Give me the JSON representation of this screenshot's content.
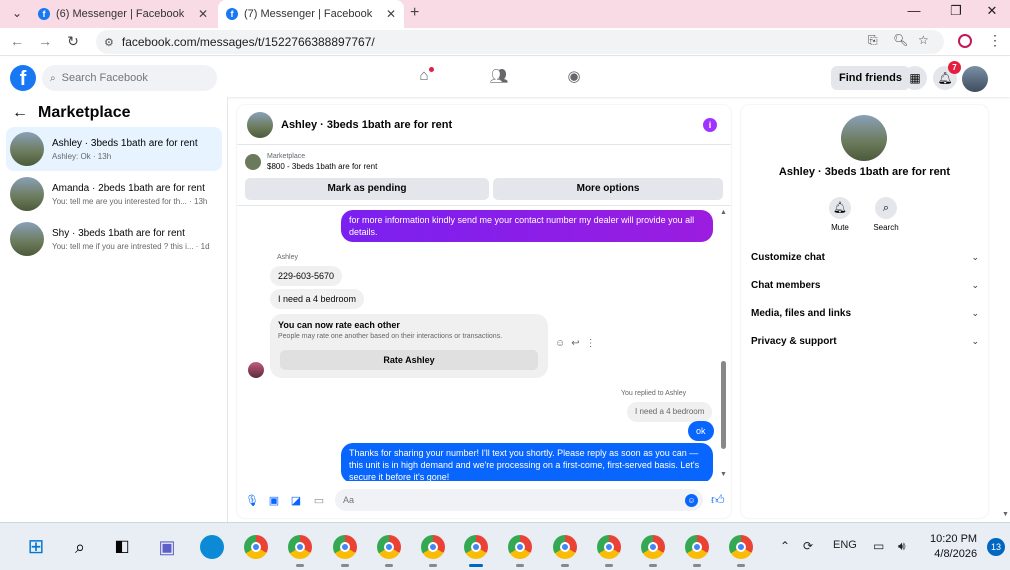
{
  "browser": {
    "tabs": [
      {
        "title": "(6) Messenger | Facebook"
      },
      {
        "title": "(7) Messenger | Facebook"
      }
    ],
    "url": "facebook.com/messages/t/1522766388897767/"
  },
  "fb": {
    "search_placeholder": "Search Facebook",
    "find_friends": "Find friends",
    "notification_count": "7"
  },
  "left": {
    "title": "Marketplace",
    "conversations": [
      {
        "title": "Ashley · 3beds 1bath are for rent",
        "preview": "Ashley: Ok · 13h"
      },
      {
        "title": "Amanda · 2beds 1bath are for rent",
        "preview": "You: tell me are you interested for th... · 13h"
      },
      {
        "title": "Shy · 3beds 1bath are for rent",
        "preview": "You: tell me if you are intrested ? this i... · 1d"
      }
    ]
  },
  "chat": {
    "title": "Ashley · 3beds 1bath are for rent",
    "marketplace_label": "Marketplace",
    "listing": "$800 - 3beds 1bath are for rent",
    "mark_pending": "Mark as pending",
    "more_options": "More options",
    "messages": {
      "out1": "for more information kindly send me your contact number my dealer will provide you all  details.",
      "sender": "Ashley",
      "in1": "229-603-5670",
      "in2": "I need a 4 bedroom",
      "rate_title": "You can now rate each other",
      "rate_desc": "People may rate one another based on their interactions or transactions.",
      "rate_button": "Rate Ashley",
      "replied_label": "You replied to Ashley",
      "quoted": "I need a 4 bedroom",
      "out2": "ok",
      "out3": "Thanks for sharing your number! I'll text you shortly. Please reply as soon as you can — this unit is in high demand and we're processing on a first-come, first-served basis. Let's secure it before it's gone!"
    },
    "composer_placeholder": "Aa"
  },
  "right": {
    "name": "Ashley · 3beds 1bath are for rent",
    "mute": "Mute",
    "search": "Search",
    "sections": [
      "Customize chat",
      "Chat members",
      "Media, files and links",
      "Privacy & support"
    ]
  },
  "taskbar": {
    "lang": "ENG",
    "time": "10:20 PM",
    "date": "4/8/2026",
    "badge": "13"
  },
  "colors": {
    "fb_blue": "#1877f2",
    "message_purple": "#8a2be2",
    "message_blue": "#0866ff",
    "tab_strip": "#f8dbe4"
  }
}
